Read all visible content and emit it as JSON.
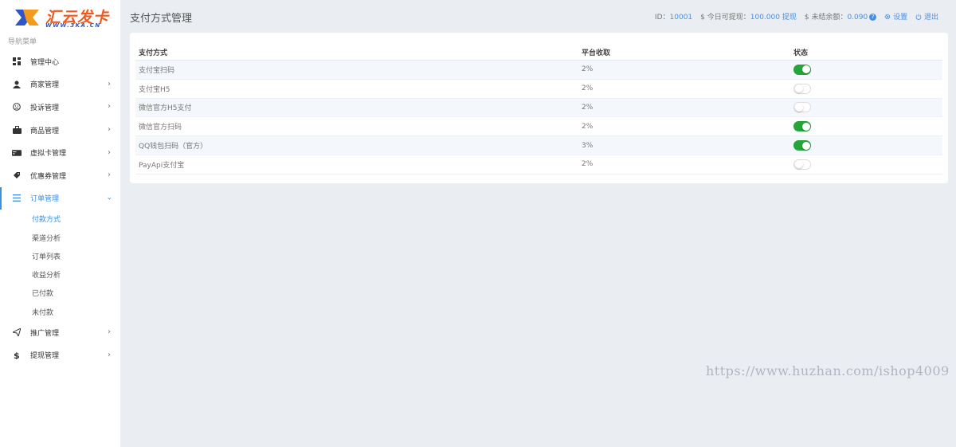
{
  "logo": {
    "title": "汇云发卡",
    "url": "WWW.3KA.CN"
  },
  "sidebar": {
    "heading": "导航菜单",
    "items": [
      {
        "label": "管理中心",
        "icon": "dashboard-icon",
        "chevron": false
      },
      {
        "label": "商家管理",
        "icon": "user-icon",
        "chevron": true
      },
      {
        "label": "投诉管理",
        "icon": "frown-icon",
        "chevron": true
      },
      {
        "label": "商品管理",
        "icon": "briefcase-icon",
        "chevron": true
      },
      {
        "label": "虚拟卡管理",
        "icon": "card-icon",
        "chevron": true
      },
      {
        "label": "优惠券管理",
        "icon": "tag-icon",
        "chevron": true
      },
      {
        "label": "订单管理",
        "icon": "list-icon",
        "chevron": true,
        "open": true,
        "children": [
          "付款方式",
          "渠道分析",
          "订单列表",
          "收益分析",
          "已付款",
          "未付款"
        ]
      },
      {
        "label": "推广管理",
        "icon": "send-icon",
        "chevron": true
      },
      {
        "label": "提现管理",
        "icon": "dollar-icon",
        "chevron": true
      }
    ]
  },
  "header": {
    "title": "支付方式管理",
    "id_label": "ID：",
    "id_value": "10001",
    "withdraw_label": "$ 今日可提现：",
    "withdraw_value": "100.000",
    "withdraw_link": "提现",
    "balance_label": "$ 未结余额：",
    "balance_value": "0.090",
    "settings": "设置",
    "logout": "退出"
  },
  "table": {
    "columns": [
      "支付方式",
      "平台收取",
      "状态"
    ],
    "rows": [
      {
        "name": "支付宝扫码",
        "fee": "2%",
        "enabled": true
      },
      {
        "name": "支付宝H5",
        "fee": "2%",
        "enabled": false
      },
      {
        "name": "微信官方H5支付",
        "fee": "2%",
        "enabled": false
      },
      {
        "name": "微信官方扫码",
        "fee": "2%",
        "enabled": true
      },
      {
        "name": "QQ钱包扫码（官方）",
        "fee": "3%",
        "enabled": true
      },
      {
        "name": "PayApi支付宝",
        "fee": "2%",
        "enabled": false
      }
    ]
  },
  "watermark": "https://www.huzhan.com/ishop4009",
  "colors": {
    "accent": "#3d8fe0",
    "switch_on": "#25a53a",
    "logo": "#ee5a1f"
  }
}
